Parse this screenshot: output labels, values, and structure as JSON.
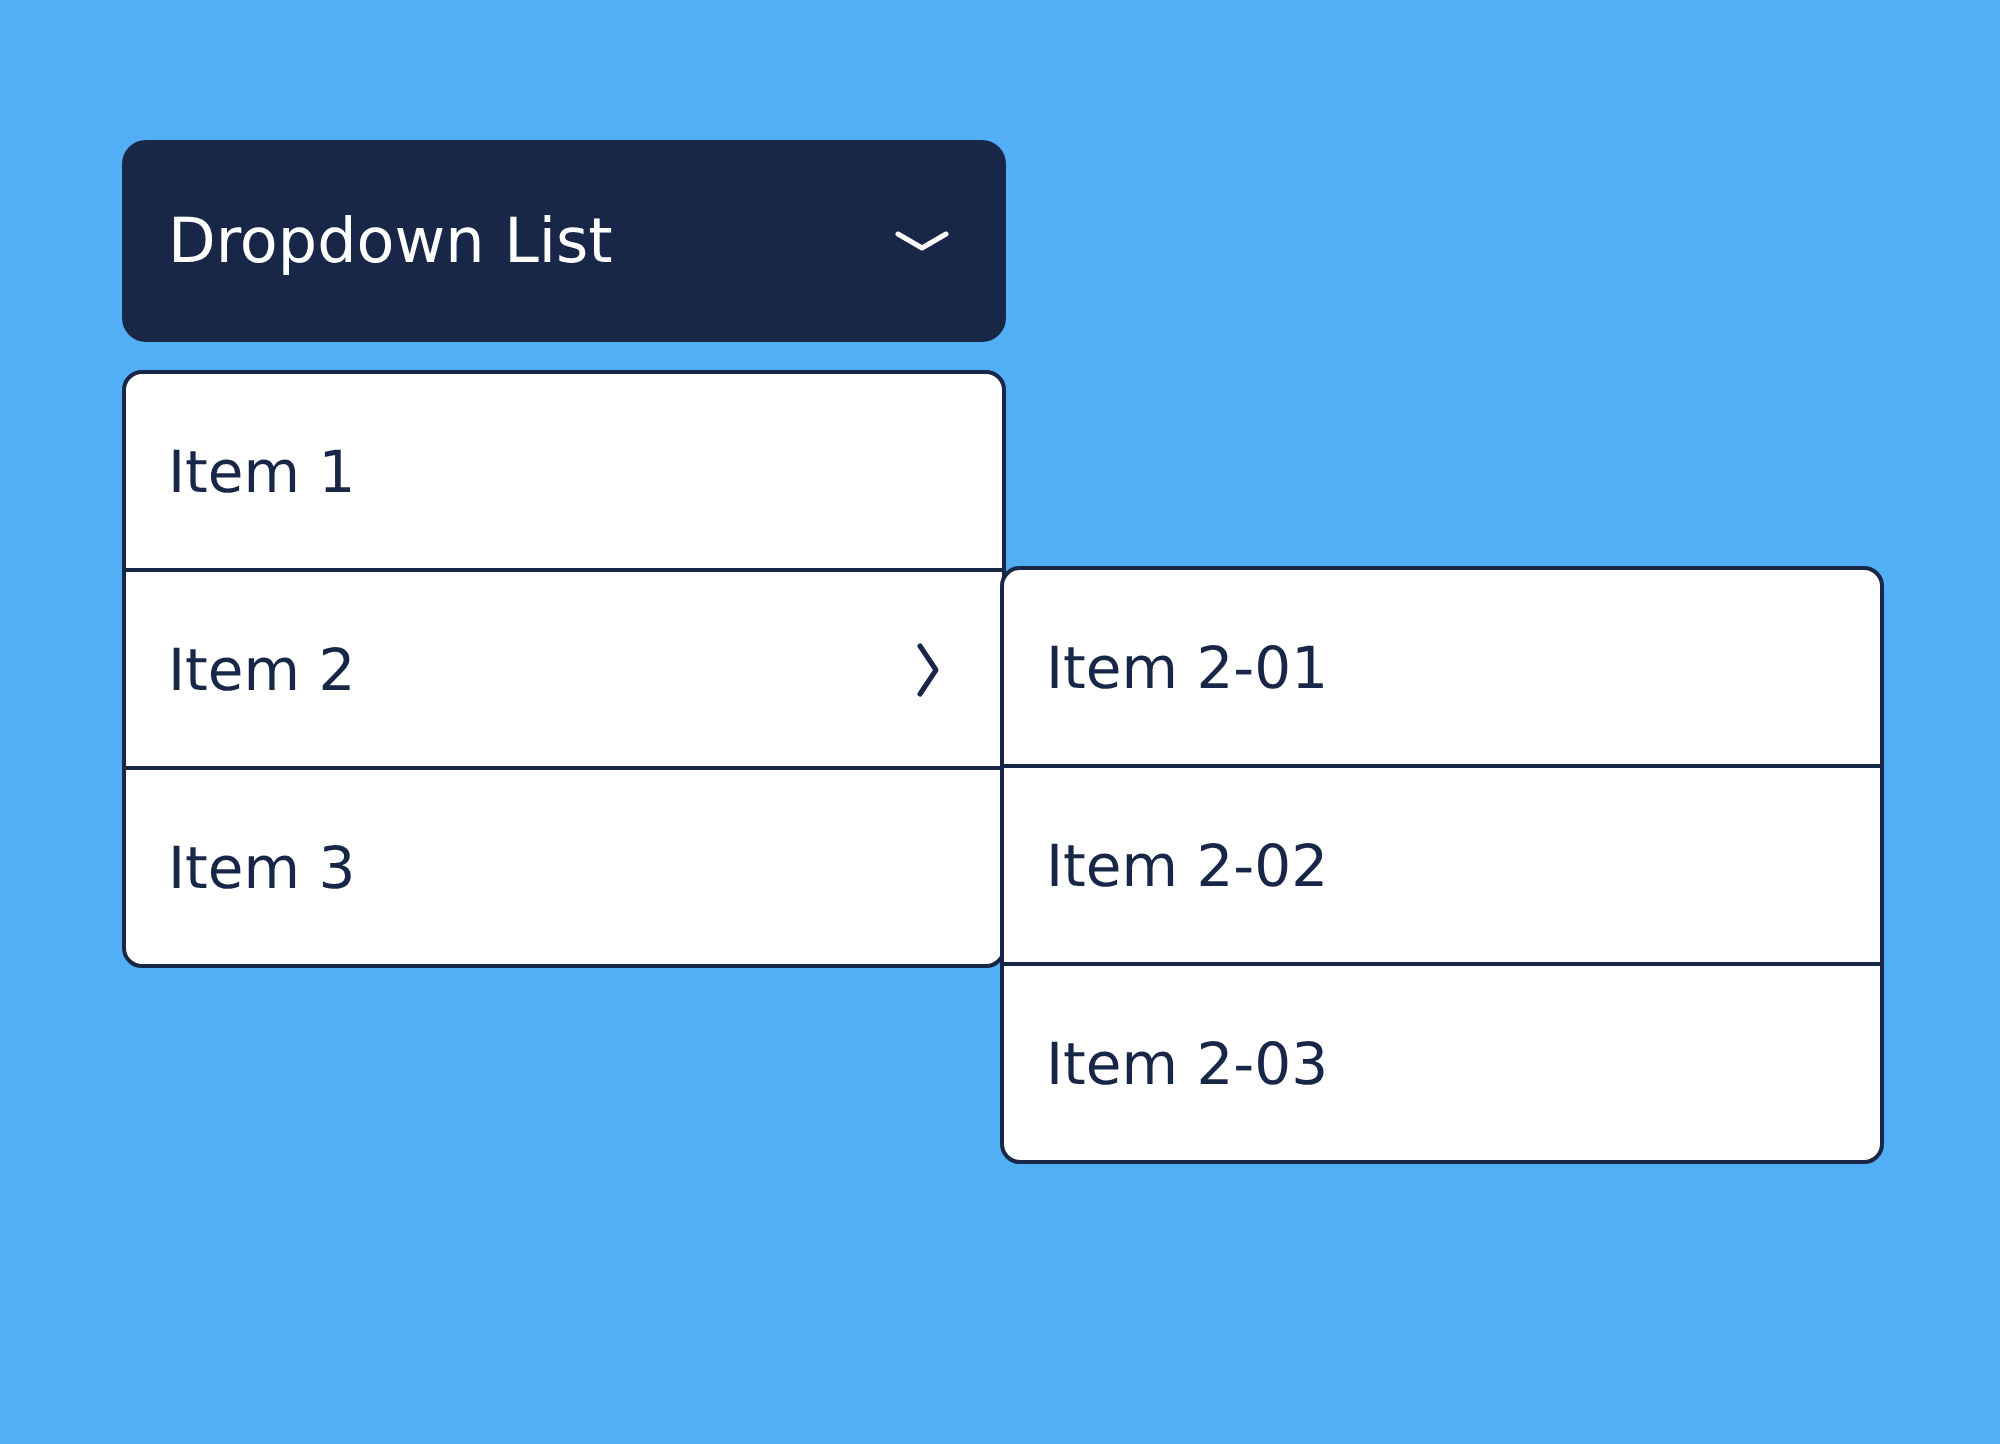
{
  "dropdown": {
    "label": "Dropdown List",
    "expanded": true
  },
  "items": [
    {
      "label": "Item 1"
    },
    {
      "label": "Item 2",
      "expanded": true,
      "children": [
        {
          "label": "Item 2-01"
        },
        {
          "label": "Item 2-02"
        },
        {
          "label": "Item 2-03"
        }
      ]
    },
    {
      "label": "Item 3"
    }
  ]
}
